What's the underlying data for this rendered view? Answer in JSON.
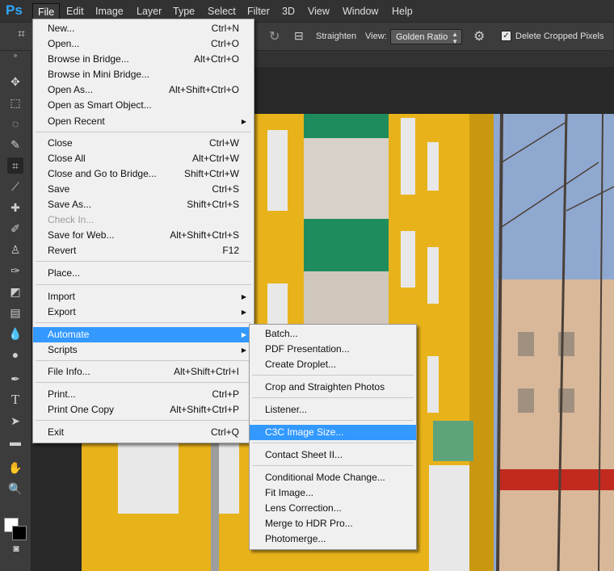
{
  "app": {
    "logo": "Ps"
  },
  "menubar": {
    "items": [
      "File",
      "Edit",
      "Image",
      "Layer",
      "Type",
      "Select",
      "Filter",
      "3D",
      "View",
      "Window",
      "Help"
    ],
    "active": "File"
  },
  "options": {
    "straighten_label": "Straighten",
    "view_label": "View:",
    "view_value": "Golden Ratio",
    "delete_cropped_label": "Delete Cropped Pixels",
    "delete_cropped_checked": true
  },
  "file_menu": {
    "items": [
      {
        "label": "New...",
        "shortcut": "Ctrl+N"
      },
      {
        "label": "Open...",
        "shortcut": "Ctrl+O"
      },
      {
        "label": "Browse in Bridge...",
        "shortcut": "Alt+Ctrl+O"
      },
      {
        "label": "Browse in Mini Bridge...",
        "shortcut": ""
      },
      {
        "label": "Open As...",
        "shortcut": "Alt+Shift+Ctrl+O"
      },
      {
        "label": "Open as Smart Object...",
        "shortcut": ""
      },
      {
        "label": "Open Recent",
        "shortcut": "",
        "submenu": true
      },
      {
        "label": "Close",
        "shortcut": "Ctrl+W"
      },
      {
        "label": "Close All",
        "shortcut": "Alt+Ctrl+W"
      },
      {
        "label": "Close and Go to Bridge...",
        "shortcut": "Shift+Ctrl+W"
      },
      {
        "label": "Save",
        "shortcut": "Ctrl+S"
      },
      {
        "label": "Save As...",
        "shortcut": "Shift+Ctrl+S"
      },
      {
        "label": "Check In...",
        "shortcut": "",
        "disabled": true
      },
      {
        "label": "Save for Web...",
        "shortcut": "Alt+Shift+Ctrl+S"
      },
      {
        "label": "Revert",
        "shortcut": "F12"
      },
      {
        "label": "Place...",
        "shortcut": ""
      },
      {
        "label": "Import",
        "shortcut": "",
        "submenu": true
      },
      {
        "label": "Export",
        "shortcut": "",
        "submenu": true
      },
      {
        "label": "Automate",
        "shortcut": "",
        "submenu": true,
        "highlighted": true
      },
      {
        "label": "Scripts",
        "shortcut": "",
        "submenu": true
      },
      {
        "label": "File Info...",
        "shortcut": "Alt+Shift+Ctrl+I"
      },
      {
        "label": "Print...",
        "shortcut": "Ctrl+P"
      },
      {
        "label": "Print One Copy",
        "shortcut": "Alt+Shift+Ctrl+P"
      },
      {
        "label": "Exit",
        "shortcut": "Ctrl+Q"
      }
    ]
  },
  "automate_menu": {
    "items": [
      {
        "label": "Batch..."
      },
      {
        "label": "PDF Presentation..."
      },
      {
        "label": "Create Droplet..."
      },
      {
        "label": "Crop and Straighten Photos"
      },
      {
        "label": "Listener..."
      },
      {
        "label": "C3C Image Size...",
        "highlighted": true
      },
      {
        "label": "Contact Sheet II..."
      },
      {
        "label": "Conditional Mode Change..."
      },
      {
        "label": "Fit Image..."
      },
      {
        "label": "Lens Correction..."
      },
      {
        "label": "Merge to HDR Pro..."
      },
      {
        "label": "Photomerge..."
      }
    ]
  },
  "colors": {
    "menu_highlight": "#3399ff",
    "building_yellow": "#e8b31a",
    "balcony_green": "#1f8c5e",
    "sky": "#8fa8d0"
  }
}
